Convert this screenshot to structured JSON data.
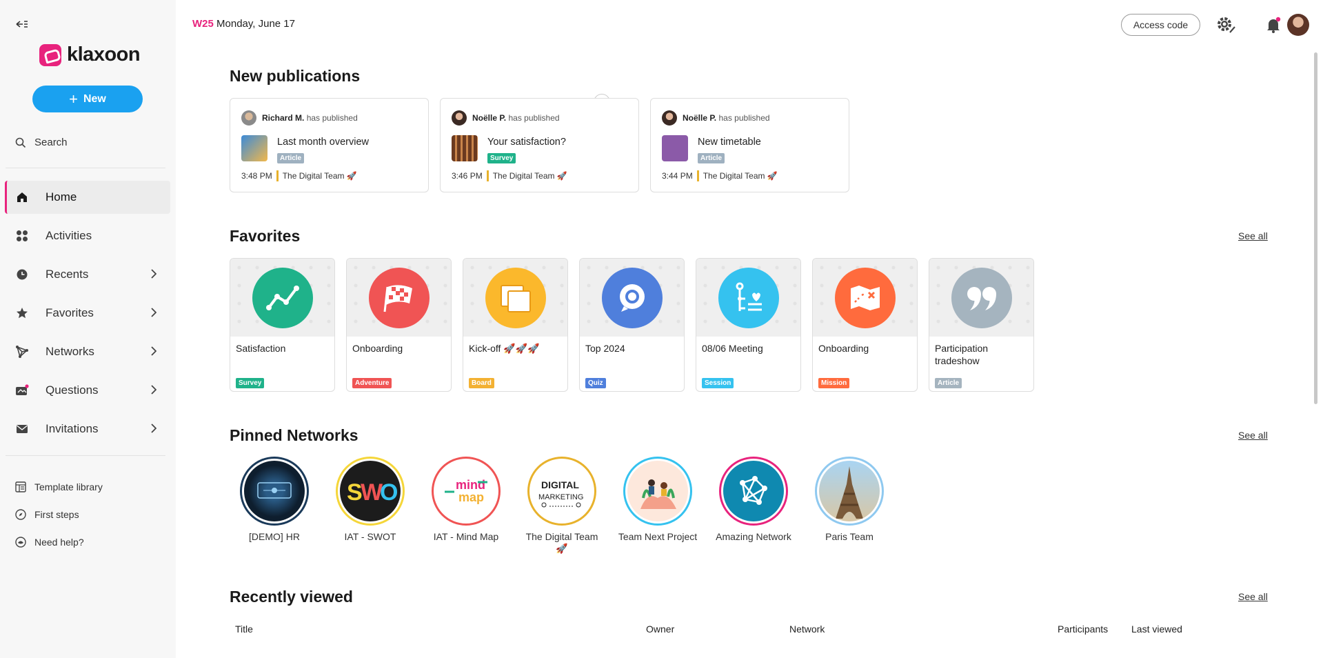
{
  "sidebar": {
    "logo": "klaxoon",
    "new_label": "New",
    "search_label": "Search",
    "nav": [
      {
        "label": "Home",
        "icon": "home-icon"
      },
      {
        "label": "Activities",
        "icon": "activities-icon"
      },
      {
        "label": "Recents",
        "icon": "clock-icon"
      },
      {
        "label": "Favorites",
        "icon": "star-icon"
      },
      {
        "label": "Networks",
        "icon": "network-icon"
      },
      {
        "label": "Questions",
        "icon": "questions-icon"
      },
      {
        "label": "Invitations",
        "icon": "mail-icon"
      }
    ],
    "footer": [
      {
        "label": "Template library",
        "icon": "template-icon"
      },
      {
        "label": "First steps",
        "icon": "compass-icon"
      },
      {
        "label": "Need help?",
        "icon": "help-icon"
      }
    ]
  },
  "topbar": {
    "week": "W25",
    "date": "Monday, June 17",
    "access_code": "Access code"
  },
  "sections": {
    "publications": "New publications",
    "favorites": "Favorites",
    "networks": "Pinned Networks",
    "recent": "Recently viewed",
    "see_all": "See all"
  },
  "publications": [
    {
      "author": "Richard M.",
      "action": "has published",
      "title": "Last month overview",
      "badge": "Article",
      "badge_color": "#9fb1c0",
      "time": "3:48 PM",
      "team": "The Digital Team 🚀"
    },
    {
      "author": "Noëlle P.",
      "action": "has published",
      "title": "Your satisfaction?",
      "badge": "Survey",
      "badge_color": "#1fb28a",
      "time": "3:46 PM",
      "team": "The Digital Team 🚀"
    },
    {
      "author": "Noëlle P.",
      "action": "has published",
      "title": "New timetable",
      "badge": "Article",
      "badge_color": "#9fb1c0",
      "time": "3:44 PM",
      "team": "The Digital Team 🚀"
    }
  ],
  "favorites": [
    {
      "name": "Satisfaction",
      "badge": "Survey",
      "color": "#1fb28a",
      "badge_color": "#1fb28a",
      "icon": "chart-line-icon"
    },
    {
      "name": "Onboarding",
      "badge": "Adventure",
      "color": "#f05454",
      "badge_color": "#f05454",
      "icon": "checkered-flag-icon"
    },
    {
      "name": "Kick-off 🚀🚀🚀",
      "badge": "Board",
      "color": "#fbb82c",
      "badge_color": "#f3b132",
      "icon": "board-icon"
    },
    {
      "name": "Top 2024",
      "badge": "Quiz",
      "color": "#4f7fdc",
      "badge_color": "#4f7fdc",
      "icon": "quiz-icon"
    },
    {
      "name": "08/06 Meeting",
      "badge": "Session",
      "color": "#35c2ef",
      "badge_color": "#35c2ef",
      "icon": "session-icon"
    },
    {
      "name": "Onboarding",
      "badge": "Mission",
      "color": "#ff6b3d",
      "badge_color": "#ff6b3d",
      "icon": "map-icon"
    },
    {
      "name": "Participation tradeshow",
      "badge": "Article",
      "color": "#a5b4bf",
      "badge_color": "#a5b4bf",
      "icon": "quote-icon"
    }
  ],
  "networks": [
    {
      "name": "[DEMO] HR",
      "ring": "#1a3a5a",
      "icon": "hr-network-icon"
    },
    {
      "name": "IAT - SWOT",
      "ring": "#f5d63a",
      "icon": "swot-network-icon"
    },
    {
      "name": "IAT - Mind Map",
      "ring": "#f05454",
      "icon": "mindmap-network-icon"
    },
    {
      "name": "The Digital Team 🚀",
      "ring": "#e8b22c",
      "icon": "digital-marketing-icon"
    },
    {
      "name": "Team Next Project",
      "ring": "#35c2ef",
      "icon": "team-network-icon"
    },
    {
      "name": "Amazing Network",
      "ring": "#e8237d",
      "icon": "amazing-network-icon"
    },
    {
      "name": "Paris Team",
      "ring": "#8fc9f0",
      "icon": "eiffel-tower-icon"
    }
  ],
  "recent_table": {
    "columns": [
      "Title",
      "Owner",
      "Network",
      "Participants",
      "Last viewed"
    ]
  }
}
